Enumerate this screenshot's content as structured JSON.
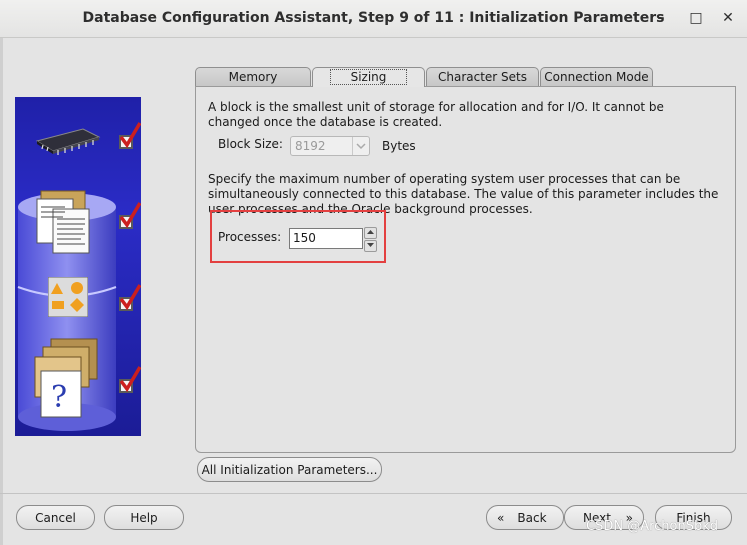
{
  "window": {
    "title": "Database Configuration Assistant, Step 9 of 11 : Initialization Parameters",
    "minimize_glyph": "–",
    "maximize_glyph": "□",
    "close_glyph": "✕"
  },
  "tabs": [
    {
      "label": "Memory",
      "active": false
    },
    {
      "label": "Sizing",
      "active": true
    },
    {
      "label": "Character Sets",
      "active": false
    },
    {
      "label": "Connection Mode",
      "active": false
    }
  ],
  "sizing": {
    "block_description": "A block is the smallest unit of storage for allocation and for I/O. It cannot be changed once the database is created.",
    "block_size_label": "Block Size:",
    "block_size_value": "8192",
    "block_size_unit": "Bytes",
    "processes_description": "Specify the maximum number of operating system user processes that can be simultaneously connected to this database. The value of this parameter includes the user processes and the Oracle background processes.",
    "processes_label": "Processes:",
    "processes_value": "150"
  },
  "buttons": {
    "all_params": "All Initialization Parameters...",
    "cancel": "Cancel",
    "help": "Help",
    "back": "Back",
    "next": "Next",
    "finish": "Finish"
  },
  "watermark": "CSDN @ArchonSbkd",
  "colors": {
    "highlight_box": "#e34040",
    "image_panel": "#2b2cc7",
    "checkmark": "#cc1f1f"
  },
  "icons": [
    "chip-icon",
    "documents-icon",
    "shapes-icon",
    "folders-question-icon",
    "checkmark-icon"
  ]
}
